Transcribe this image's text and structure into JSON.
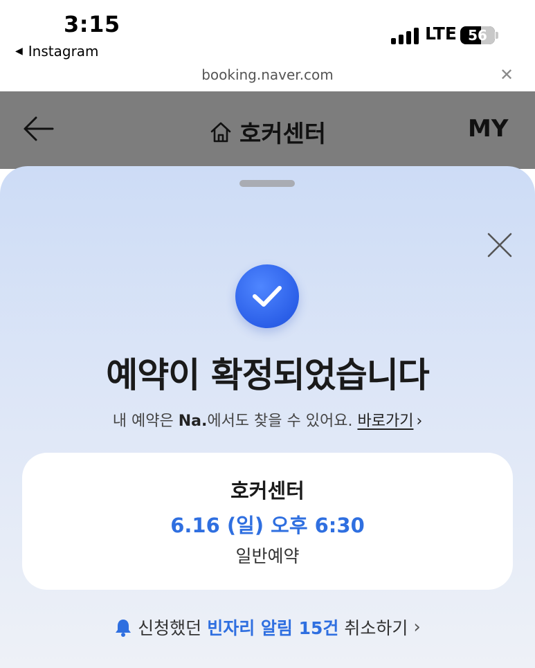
{
  "status_bar": {
    "time": "3:15",
    "back_app": "Instagram",
    "network": "LTE",
    "battery": "56"
  },
  "url_bar": {
    "url": "booking.naver.com"
  },
  "page_header": {
    "title": "호커센터",
    "my_label": "MY"
  },
  "sheet": {
    "headline": "예약이 확정되었습니다",
    "sub_before": "내 예약은 ",
    "sub_brand": "Na.",
    "sub_after": "에서도 찾을 수 있어요.",
    "sub_link": "바로가기",
    "card": {
      "place": "호커센터",
      "datetime": "6.16 (일) 오후 6:30",
      "type": "일반예약"
    },
    "notice": {
      "prefix": "신청했던",
      "highlight": "빈자리 알림 15건",
      "action": "취소하기"
    }
  },
  "colors": {
    "accent": "#2f6fe0",
    "check_circle": "#2b5fe8"
  }
}
